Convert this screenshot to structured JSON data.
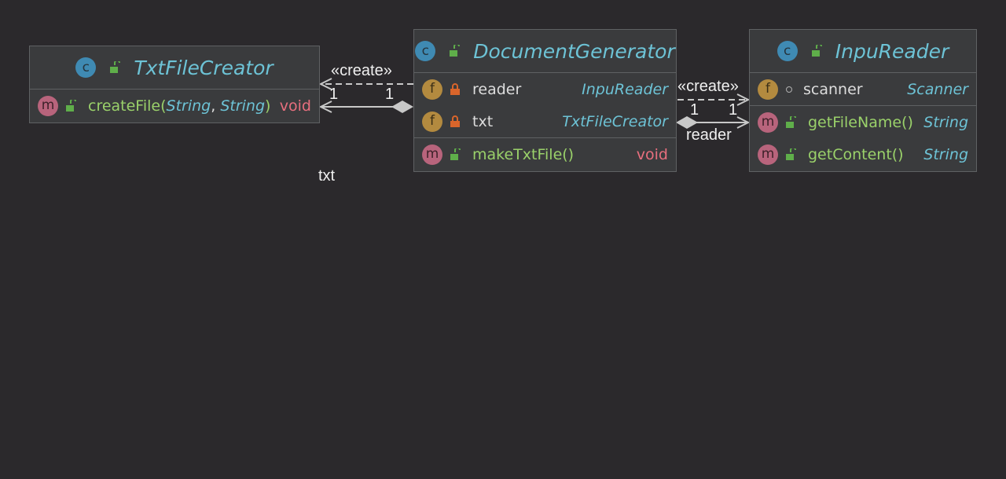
{
  "classes": {
    "txtfilecreator": {
      "kind_icon": "c",
      "name": "TxtFileCreator",
      "methods": [
        {
          "icon": "m",
          "name": "createFile",
          "paren_open": "(",
          "param1": "String",
          "comma": ",",
          "param2": "String",
          "paren_close": ")",
          "return_type": "void"
        }
      ]
    },
    "documentgenerator": {
      "kind_icon": "c",
      "name": "DocumentGenerator",
      "fields": [
        {
          "icon": "f",
          "name": "reader",
          "type": "InpuReader"
        },
        {
          "icon": "f",
          "name": "txt",
          "type": "TxtFileCreator"
        }
      ],
      "methods": [
        {
          "icon": "m",
          "name": "makeTxtFile",
          "parens": "()",
          "return_type": "void"
        }
      ]
    },
    "inpureader": {
      "kind_icon": "c",
      "name": "InpuReader",
      "fields": [
        {
          "icon": "f",
          "name": "scanner",
          "type": "Scanner"
        }
      ],
      "methods": [
        {
          "icon": "m",
          "name": "getFileName",
          "parens": "()",
          "return_type": "String"
        },
        {
          "icon": "m",
          "name": "getContent",
          "parens": "()",
          "return_type": "String"
        }
      ]
    }
  },
  "edges": {
    "create_left": "«create»",
    "create_right": "«create»",
    "txt_assoc": {
      "mult_source": "1",
      "mult_target": "1",
      "role": "txt"
    },
    "reader_assoc": {
      "mult_source": "1",
      "mult_target": "1",
      "role": "reader"
    }
  },
  "colors": {
    "background": "#2b292c",
    "class_name": "#6dc3d6",
    "method_name": "#9ad16a",
    "void_type": "#e86f7e",
    "lock_private": "#d9652b",
    "unlock_public": "#5fae4a"
  },
  "icons": {
    "class_icon": "class-c-icon",
    "field_icon": "field-f-icon",
    "method_icon": "method-m-icon",
    "public_icon": "unlock-icon",
    "private_icon": "lock-icon",
    "package_icon": "package-dot-icon"
  }
}
